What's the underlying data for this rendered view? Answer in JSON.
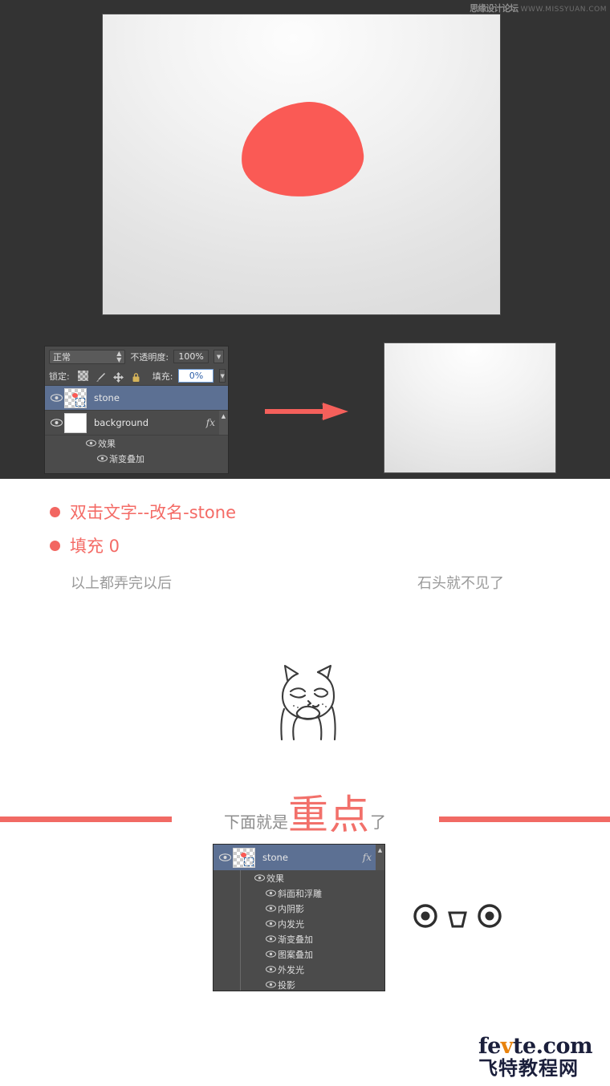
{
  "watermark": {
    "site_cn": "思缘设计论坛",
    "site_url": "WWW.MISSYUAN.COM"
  },
  "canvas_top": {
    "shape_name": "stone-blob",
    "shape_color": "#fa5a55",
    "background_desc": "radial light gray gradient"
  },
  "canvas_small": {
    "background_desc": "radial light gray gradient, stone hidden"
  },
  "arrow": {
    "color": "#f5605b",
    "direction": "right"
  },
  "layers_panel_top": {
    "blend_mode": "正常",
    "opacity_label": "不透明度:",
    "opacity_value": "100%",
    "lock_label": "锁定:",
    "fill_label": "填充:",
    "fill_value": "0%",
    "lock_icons": [
      "transparency-lock-icon",
      "brush-lock-icon",
      "move-lock-icon",
      "all-lock-icon"
    ],
    "layers": [
      {
        "name": "stone",
        "selected": true,
        "has_fx": false,
        "thumb": "transparent-shape"
      },
      {
        "name": "background",
        "selected": false,
        "has_fx": true,
        "thumb": "white"
      }
    ],
    "effects_group_label": "效果",
    "effects": [
      "渐变叠加"
    ]
  },
  "annotations": [
    {
      "text": "双击文字--改名-stone"
    },
    {
      "text": "填充 0"
    }
  ],
  "captions": {
    "left": "以上都弄完以后",
    "right": "石头就不见了"
  },
  "meme": {
    "name": "thinking-cat"
  },
  "focus_banner": {
    "prefix": "下面就是",
    "highlight": "重点",
    "suffix": "了",
    "divider_color": "#f16a64"
  },
  "layers_panel_bottom": {
    "layer": {
      "name": "stone",
      "selected": true,
      "has_fx": true
    },
    "effects_group_label": "效果",
    "effects": [
      "斜面和浮雕",
      "内阴影",
      "内发光",
      "渐变叠加",
      "图案叠加",
      "外发光",
      "投影"
    ]
  },
  "emoticon": {
    "name": "surprised-face"
  },
  "footer_logo": {
    "en_part1": "fe",
    "en_accent": "v",
    "en_part2": "te.com",
    "cn": "飞特教程网"
  }
}
